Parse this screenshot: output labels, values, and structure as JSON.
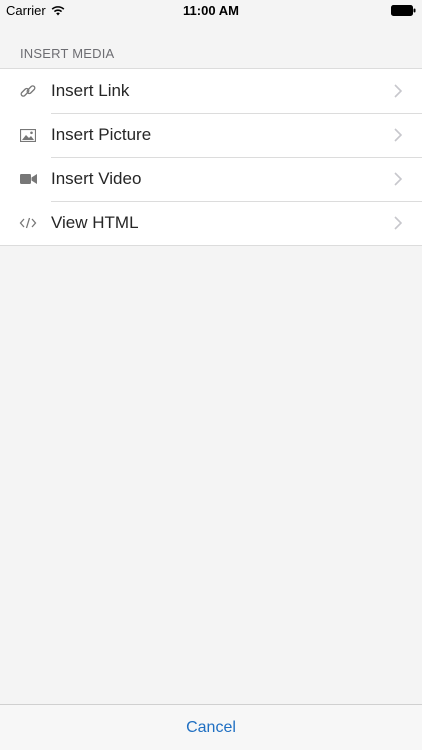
{
  "status_bar": {
    "carrier": "Carrier",
    "time": "11:00 AM",
    "wifi_icon": "wifi-icon",
    "battery_icon": "battery-icon"
  },
  "section": {
    "title": "INSERT MEDIA"
  },
  "menu": {
    "items": [
      {
        "label": "Insert Link",
        "icon": "link-icon"
      },
      {
        "label": "Insert Picture",
        "icon": "image-icon"
      },
      {
        "label": "Insert Video",
        "icon": "video-camera-icon"
      },
      {
        "label": "View HTML",
        "icon": "code-icon"
      }
    ]
  },
  "footer": {
    "cancel_label": "Cancel"
  },
  "colors": {
    "background": "#f4f4f4",
    "accent": "#1f6fc2",
    "section_header": "#6d6d72",
    "icon": "#777777",
    "chevron": "#c7c7cc"
  }
}
